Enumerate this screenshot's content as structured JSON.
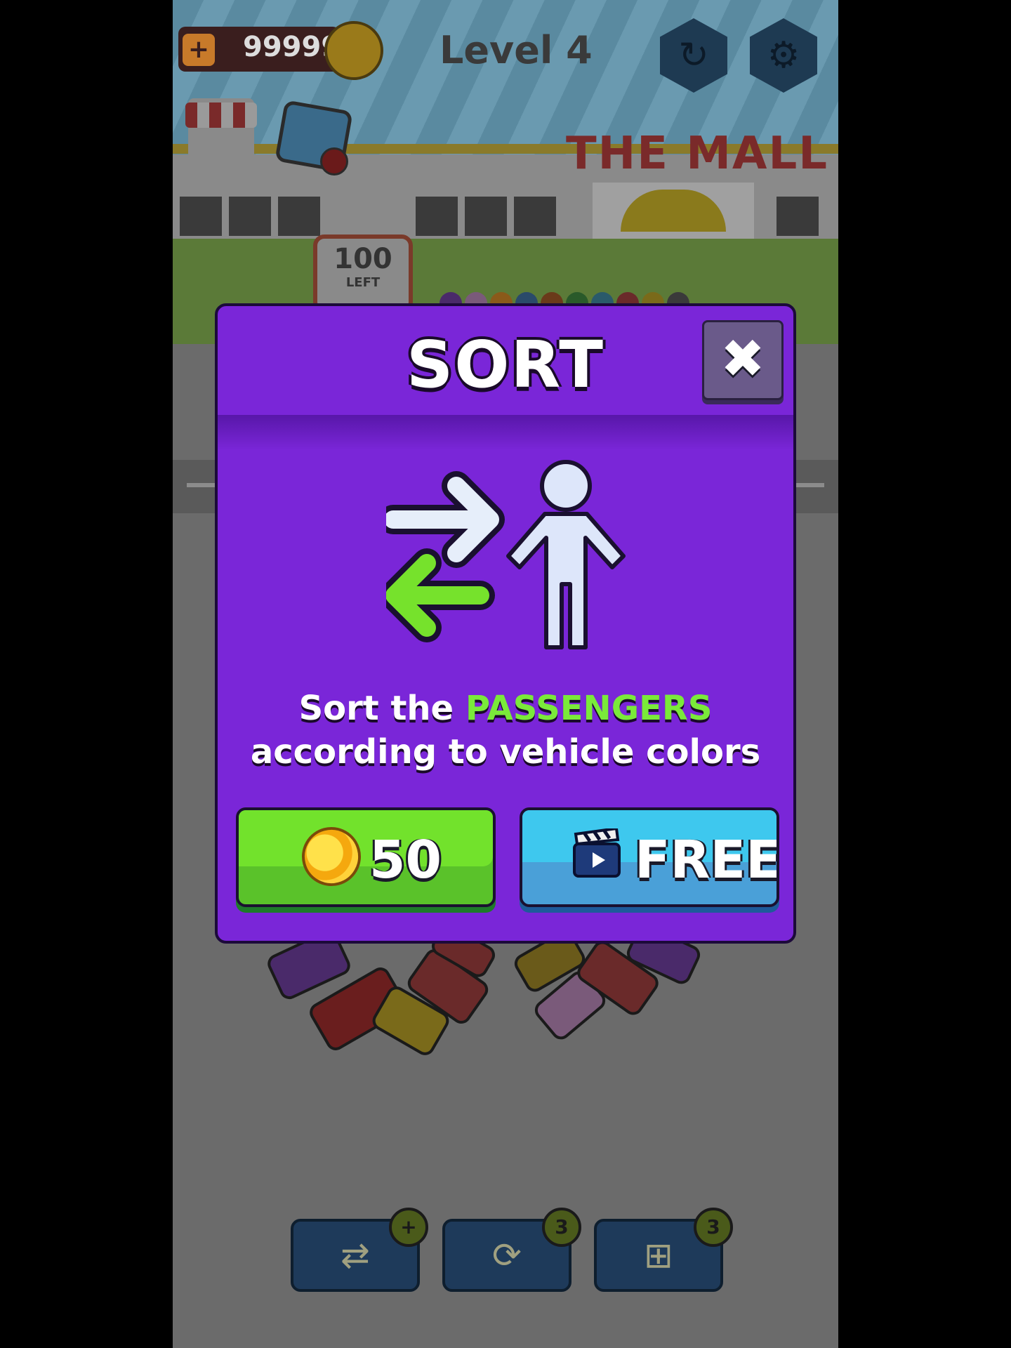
{
  "hud": {
    "coins": "99999",
    "add_coins_label": "+",
    "level": "Level 4"
  },
  "scene": {
    "mall_sign": "THE MALL",
    "passengers_left_count": "100",
    "passengers_left_label": "LEFT"
  },
  "boosters": [
    {
      "name": "sort-passengers",
      "badge": "+"
    },
    {
      "name": "shuffle-vehicles",
      "badge": "3"
    },
    {
      "name": "add-vehicle",
      "badge": "3"
    }
  ],
  "modal": {
    "title": "SORT",
    "description_part1": "Sort the ",
    "description_highlight": "PASSENGERS",
    "description_line2": "according to vehicle colors",
    "buy_price": "50",
    "free_label": "FREE",
    "colors": {
      "panel": "#7a26d8",
      "highlight": "#7aea3a",
      "buy_button": "#72e22c",
      "free_button": "#3ec8ee"
    }
  }
}
